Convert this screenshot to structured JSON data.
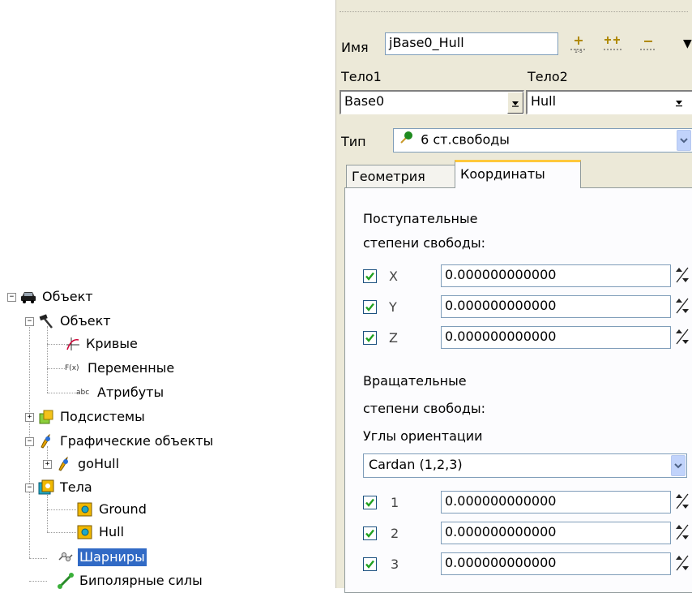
{
  "tree": {
    "root": "Объект",
    "object": "Объект",
    "curves": "Кривые",
    "variables": "Переменные",
    "attributes": "Атрибуты",
    "subsystems": "Подсистемы",
    "graphic_objects": "Графические объекты",
    "gohull": "goHull",
    "bodies": "Тела",
    "ground": "Ground",
    "hull": "Hull",
    "joints": "Шарниры",
    "bipolar_forces": "Биполярные силы",
    "icon_labels": {
      "variables": "F(x)",
      "attributes": "abc"
    }
  },
  "panel": {
    "name_label": "Имя",
    "name_value": "jBase0_Hull",
    "body1_label": "Тело1",
    "body2_label": "Тело2",
    "body1_value": "Base0",
    "body2_value": "Hull",
    "type_label": "Тип",
    "type_value": "6 ст.свободы",
    "tabs": [
      "Геометрия",
      "Координаты"
    ],
    "translational_title_1": "Поступательные",
    "translational_title_2": "степени свободы:",
    "translational": [
      {
        "label": "X",
        "value": "0.000000000000",
        "checked": true
      },
      {
        "label": "Y",
        "value": "0.000000000000",
        "checked": true
      },
      {
        "label": "Z",
        "value": "0.000000000000",
        "checked": true
      }
    ],
    "rotational_title_1": "Вращательные",
    "rotational_title_2": "степени свободы:",
    "angles_label": "Углы ориентации",
    "angles_value": "Cardan (1,2,3)",
    "rotational": [
      {
        "label": "1",
        "value": "0.000000000000",
        "checked": true
      },
      {
        "label": "2",
        "value": "0.000000000000",
        "checked": true
      },
      {
        "label": "3",
        "value": "0.000000000000",
        "checked": true
      }
    ]
  },
  "colors": {
    "selection": "#316ac5",
    "panel_bg": "#ece9d8",
    "active_tab_accent": "#ffc83c",
    "check_mark": "#21a121"
  }
}
